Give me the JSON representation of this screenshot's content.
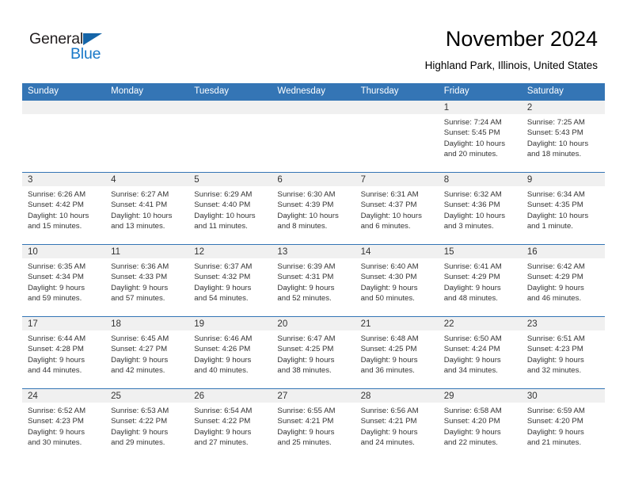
{
  "brand": {
    "name_dark": "General",
    "name_blue": "Blue",
    "accent_color": "#1878c8",
    "triangle_color": "#1565a8"
  },
  "header": {
    "title": "November 2024",
    "subtitle": "Highland Park, Illinois, United States"
  },
  "theme": {
    "header_row_bg": "#3475b5",
    "header_row_text": "#ffffff",
    "daynum_band_bg": "#f0f0f0",
    "cell_text": "#333333",
    "row_divider": "#3475b5"
  },
  "weekdays": [
    "Sunday",
    "Monday",
    "Tuesday",
    "Wednesday",
    "Thursday",
    "Friday",
    "Saturday"
  ],
  "weeks": [
    [
      {
        "day": "",
        "sunrise": "",
        "sunset": "",
        "daylight_a": "",
        "daylight_b": ""
      },
      {
        "day": "",
        "sunrise": "",
        "sunset": "",
        "daylight_a": "",
        "daylight_b": ""
      },
      {
        "day": "",
        "sunrise": "",
        "sunset": "",
        "daylight_a": "",
        "daylight_b": ""
      },
      {
        "day": "",
        "sunrise": "",
        "sunset": "",
        "daylight_a": "",
        "daylight_b": ""
      },
      {
        "day": "",
        "sunrise": "",
        "sunset": "",
        "daylight_a": "",
        "daylight_b": ""
      },
      {
        "day": "1",
        "sunrise": "Sunrise: 7:24 AM",
        "sunset": "Sunset: 5:45 PM",
        "daylight_a": "Daylight: 10 hours",
        "daylight_b": "and 20 minutes."
      },
      {
        "day": "2",
        "sunrise": "Sunrise: 7:25 AM",
        "sunset": "Sunset: 5:43 PM",
        "daylight_a": "Daylight: 10 hours",
        "daylight_b": "and 18 minutes."
      }
    ],
    [
      {
        "day": "3",
        "sunrise": "Sunrise: 6:26 AM",
        "sunset": "Sunset: 4:42 PM",
        "daylight_a": "Daylight: 10 hours",
        "daylight_b": "and 15 minutes."
      },
      {
        "day": "4",
        "sunrise": "Sunrise: 6:27 AM",
        "sunset": "Sunset: 4:41 PM",
        "daylight_a": "Daylight: 10 hours",
        "daylight_b": "and 13 minutes."
      },
      {
        "day": "5",
        "sunrise": "Sunrise: 6:29 AM",
        "sunset": "Sunset: 4:40 PM",
        "daylight_a": "Daylight: 10 hours",
        "daylight_b": "and 11 minutes."
      },
      {
        "day": "6",
        "sunrise": "Sunrise: 6:30 AM",
        "sunset": "Sunset: 4:39 PM",
        "daylight_a": "Daylight: 10 hours",
        "daylight_b": "and 8 minutes."
      },
      {
        "day": "7",
        "sunrise": "Sunrise: 6:31 AM",
        "sunset": "Sunset: 4:37 PM",
        "daylight_a": "Daylight: 10 hours",
        "daylight_b": "and 6 minutes."
      },
      {
        "day": "8",
        "sunrise": "Sunrise: 6:32 AM",
        "sunset": "Sunset: 4:36 PM",
        "daylight_a": "Daylight: 10 hours",
        "daylight_b": "and 3 minutes."
      },
      {
        "day": "9",
        "sunrise": "Sunrise: 6:34 AM",
        "sunset": "Sunset: 4:35 PM",
        "daylight_a": "Daylight: 10 hours",
        "daylight_b": "and 1 minute."
      }
    ],
    [
      {
        "day": "10",
        "sunrise": "Sunrise: 6:35 AM",
        "sunset": "Sunset: 4:34 PM",
        "daylight_a": "Daylight: 9 hours",
        "daylight_b": "and 59 minutes."
      },
      {
        "day": "11",
        "sunrise": "Sunrise: 6:36 AM",
        "sunset": "Sunset: 4:33 PM",
        "daylight_a": "Daylight: 9 hours",
        "daylight_b": "and 57 minutes."
      },
      {
        "day": "12",
        "sunrise": "Sunrise: 6:37 AM",
        "sunset": "Sunset: 4:32 PM",
        "daylight_a": "Daylight: 9 hours",
        "daylight_b": "and 54 minutes."
      },
      {
        "day": "13",
        "sunrise": "Sunrise: 6:39 AM",
        "sunset": "Sunset: 4:31 PM",
        "daylight_a": "Daylight: 9 hours",
        "daylight_b": "and 52 minutes."
      },
      {
        "day": "14",
        "sunrise": "Sunrise: 6:40 AM",
        "sunset": "Sunset: 4:30 PM",
        "daylight_a": "Daylight: 9 hours",
        "daylight_b": "and 50 minutes."
      },
      {
        "day": "15",
        "sunrise": "Sunrise: 6:41 AM",
        "sunset": "Sunset: 4:29 PM",
        "daylight_a": "Daylight: 9 hours",
        "daylight_b": "and 48 minutes."
      },
      {
        "day": "16",
        "sunrise": "Sunrise: 6:42 AM",
        "sunset": "Sunset: 4:29 PM",
        "daylight_a": "Daylight: 9 hours",
        "daylight_b": "and 46 minutes."
      }
    ],
    [
      {
        "day": "17",
        "sunrise": "Sunrise: 6:44 AM",
        "sunset": "Sunset: 4:28 PM",
        "daylight_a": "Daylight: 9 hours",
        "daylight_b": "and 44 minutes."
      },
      {
        "day": "18",
        "sunrise": "Sunrise: 6:45 AM",
        "sunset": "Sunset: 4:27 PM",
        "daylight_a": "Daylight: 9 hours",
        "daylight_b": "and 42 minutes."
      },
      {
        "day": "19",
        "sunrise": "Sunrise: 6:46 AM",
        "sunset": "Sunset: 4:26 PM",
        "daylight_a": "Daylight: 9 hours",
        "daylight_b": "and 40 minutes."
      },
      {
        "day": "20",
        "sunrise": "Sunrise: 6:47 AM",
        "sunset": "Sunset: 4:25 PM",
        "daylight_a": "Daylight: 9 hours",
        "daylight_b": "and 38 minutes."
      },
      {
        "day": "21",
        "sunrise": "Sunrise: 6:48 AM",
        "sunset": "Sunset: 4:25 PM",
        "daylight_a": "Daylight: 9 hours",
        "daylight_b": "and 36 minutes."
      },
      {
        "day": "22",
        "sunrise": "Sunrise: 6:50 AM",
        "sunset": "Sunset: 4:24 PM",
        "daylight_a": "Daylight: 9 hours",
        "daylight_b": "and 34 minutes."
      },
      {
        "day": "23",
        "sunrise": "Sunrise: 6:51 AM",
        "sunset": "Sunset: 4:23 PM",
        "daylight_a": "Daylight: 9 hours",
        "daylight_b": "and 32 minutes."
      }
    ],
    [
      {
        "day": "24",
        "sunrise": "Sunrise: 6:52 AM",
        "sunset": "Sunset: 4:23 PM",
        "daylight_a": "Daylight: 9 hours",
        "daylight_b": "and 30 minutes."
      },
      {
        "day": "25",
        "sunrise": "Sunrise: 6:53 AM",
        "sunset": "Sunset: 4:22 PM",
        "daylight_a": "Daylight: 9 hours",
        "daylight_b": "and 29 minutes."
      },
      {
        "day": "26",
        "sunrise": "Sunrise: 6:54 AM",
        "sunset": "Sunset: 4:22 PM",
        "daylight_a": "Daylight: 9 hours",
        "daylight_b": "and 27 minutes."
      },
      {
        "day": "27",
        "sunrise": "Sunrise: 6:55 AM",
        "sunset": "Sunset: 4:21 PM",
        "daylight_a": "Daylight: 9 hours",
        "daylight_b": "and 25 minutes."
      },
      {
        "day": "28",
        "sunrise": "Sunrise: 6:56 AM",
        "sunset": "Sunset: 4:21 PM",
        "daylight_a": "Daylight: 9 hours",
        "daylight_b": "and 24 minutes."
      },
      {
        "day": "29",
        "sunrise": "Sunrise: 6:58 AM",
        "sunset": "Sunset: 4:20 PM",
        "daylight_a": "Daylight: 9 hours",
        "daylight_b": "and 22 minutes."
      },
      {
        "day": "30",
        "sunrise": "Sunrise: 6:59 AM",
        "sunset": "Sunset: 4:20 PM",
        "daylight_a": "Daylight: 9 hours",
        "daylight_b": "and 21 minutes."
      }
    ]
  ]
}
